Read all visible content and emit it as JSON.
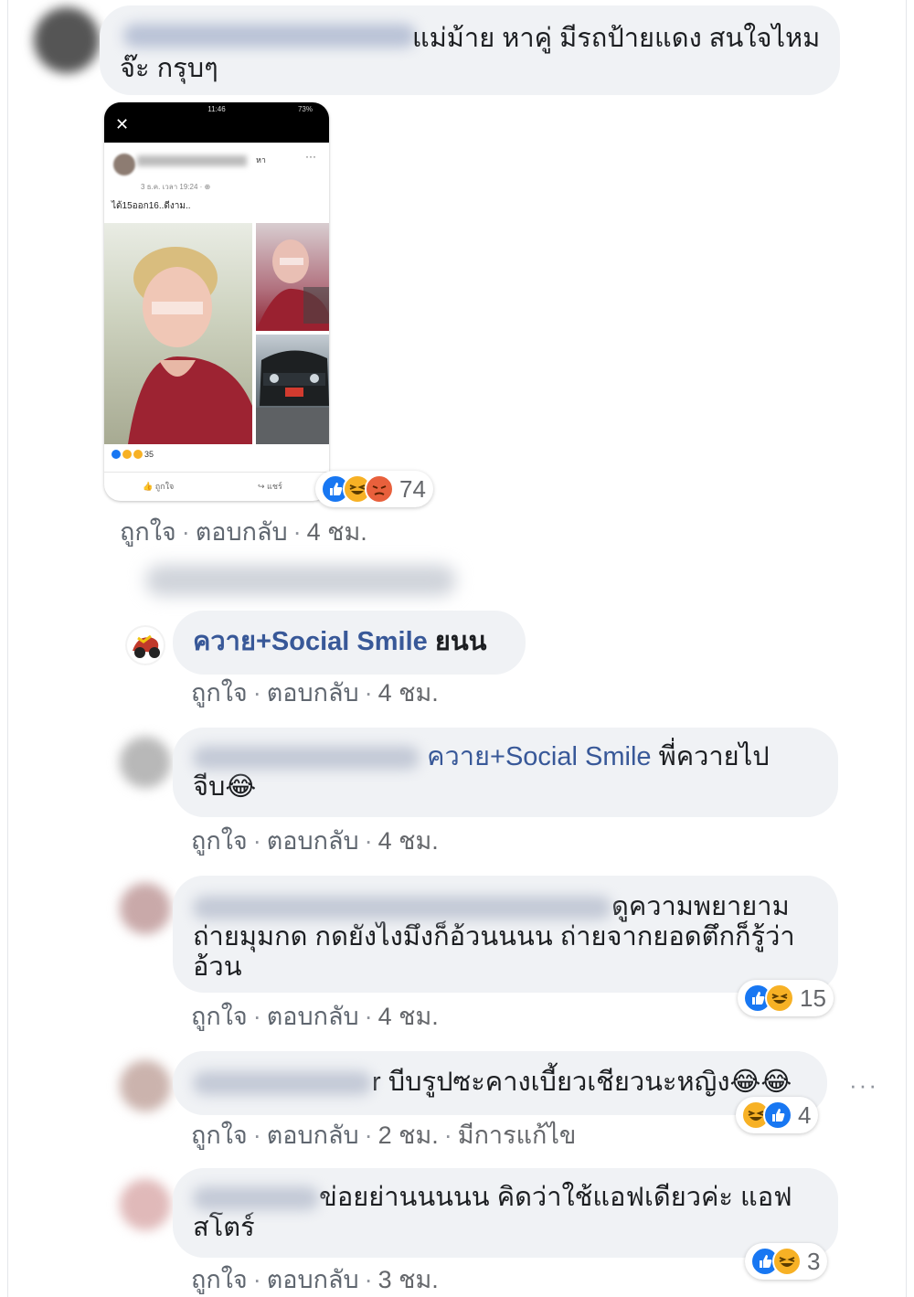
{
  "colors": {
    "like": "#1877f2",
    "haha": "#f7b125",
    "angry": "#e8603c",
    "link": "#385898",
    "bubble": "#f0f2f5",
    "meta": "#65676b"
  },
  "comments": [
    {
      "text": "แม่ม้าย หาคู่ มีรถป้ายแดง สนใจไหมจ๊ะ กรุบๆ",
      "meta": {
        "like": "ถูกใจ",
        "reply": "ตอบกลับ",
        "time": "4 ชม."
      },
      "reactions": {
        "icons": [
          "like-icon",
          "haha-icon",
          "angry-icon"
        ],
        "count": "74"
      },
      "attachment": {
        "status_time": "11:46",
        "status_battery": "73%",
        "close": "✕",
        "post_author_suffix": "หา",
        "more": "···",
        "post_date": "3 ธ.ค. เวลา 19:24 · ⊕",
        "post_text": "ได้15ออก16..ดีงาม..",
        "reaction_count": "35",
        "like_label": "ถูกใจ",
        "share_label": "แชร์"
      }
    },
    {
      "name": "ควาย+Social Smile",
      "text": "ยนน",
      "meta": {
        "like": "ถูกใจ",
        "reply": "ตอบกลับ",
        "time": "4 ชม."
      }
    },
    {
      "mention": "ควาย+Social Smile",
      "text_after": "พี่ควายไป",
      "text_line2": "จีบ",
      "emoji": "😂",
      "meta": {
        "like": "ถูกใจ",
        "reply": "ตอบกลับ",
        "time": "4 ชม."
      }
    },
    {
      "text_line1": "ดูความพยายาม",
      "text_line2": "ถ่ายมุมกด กดยังไงมึงก็อ้วนนนน ถ่ายจากยอดตึกก็รู้ว่า",
      "text_line3": "อ้วน",
      "meta": {
        "like": "ถูกใจ",
        "reply": "ตอบกลับ",
        "time": "4 ชม."
      },
      "reactions": {
        "icons": [
          "like-icon",
          "haha-icon"
        ],
        "count": "15"
      }
    },
    {
      "text_prefix": "r",
      "text": "บีบรูปซะคางเบี้ยวเชียวนะหญิง",
      "emoji": "😂😂",
      "meta": {
        "like": "ถูกใจ",
        "reply": "ตอบกลับ",
        "time": "2 ชม.",
        "edited": "มีการแก้ไข"
      },
      "reactions": {
        "icons": [
          "haha-icon",
          "like-icon"
        ],
        "count": "4"
      },
      "more": "···"
    },
    {
      "text_line1": "ข่อยย่านนนนน คิดว่าใช้แอฟเดียวค่ะ แอฟ",
      "text_line2": "สโตร์",
      "meta": {
        "like": "ถูกใจ",
        "reply": "ตอบกลับ",
        "time": "3 ชม."
      },
      "reactions": {
        "icons": [
          "like-icon",
          "haha-icon"
        ],
        "count": "3"
      }
    }
  ]
}
